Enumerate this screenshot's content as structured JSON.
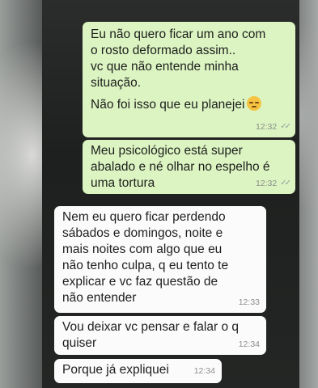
{
  "messages": [
    {
      "direction": "out",
      "text": "Eu não quero ficar um ano com\no rosto deformado assim..\nvc que não entende minha\nsituação.",
      "text2": "Não foi isso que eu planejei",
      "emoji": "pensive-face-icon",
      "time": "12:32",
      "status": "read"
    },
    {
      "direction": "out",
      "text": "Meu psicológico está super\nabalado e né olhar no espelho é\numa tortura",
      "time": "12:32",
      "status": "read"
    },
    {
      "direction": "in",
      "text": "Nem eu quero ficar perdendo\nsábados e domingos, noite e\nmais noites com algo que eu\nnão tenho culpa, q eu tento te\nexplicar e vc faz questão de\nnão entender",
      "time": "12:33"
    },
    {
      "direction": "in",
      "text": "Vou deixar vc pensar e falar o q\nquiser",
      "time": "12:34"
    },
    {
      "direction": "in",
      "text": "Porque já expliquei",
      "time": "12:34"
    }
  ],
  "colors": {
    "outgoing_bubble": "#dcf4c2",
    "incoming_bubble": "#fbfbfb",
    "background": "#1e201f"
  }
}
